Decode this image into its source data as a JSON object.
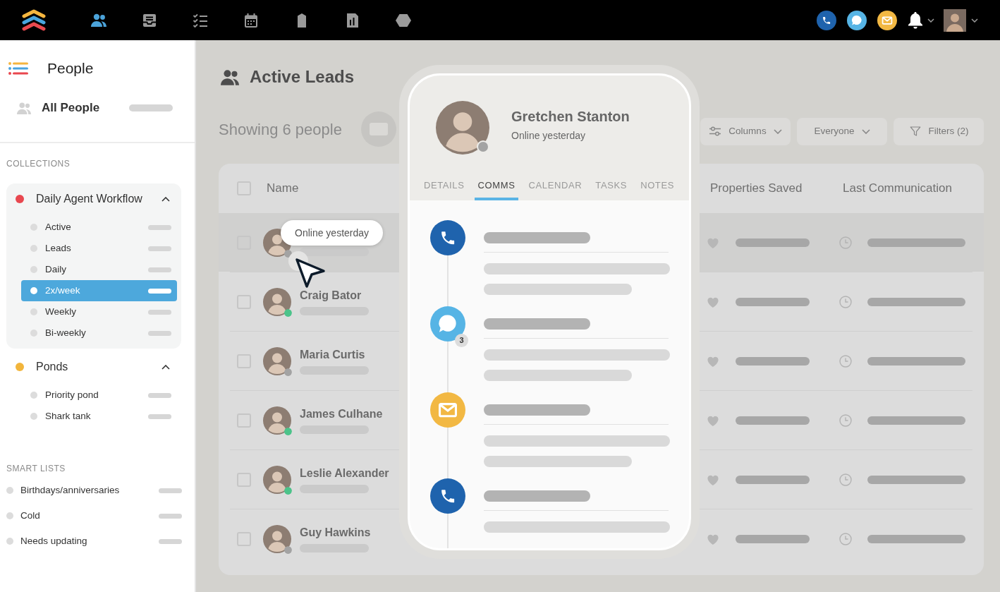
{
  "top_nav": {
    "items": [
      {
        "kind": "people",
        "selected": true
      },
      {
        "kind": "inbox",
        "selected": false
      },
      {
        "kind": "checklist",
        "selected": false
      },
      {
        "kind": "calendar",
        "selected": false
      },
      {
        "kind": "house",
        "selected": false
      },
      {
        "kind": "report",
        "selected": false
      },
      {
        "kind": "hexagon",
        "selected": false
      }
    ],
    "actions": [
      {
        "kind": "call"
      },
      {
        "kind": "message"
      },
      {
        "kind": "email"
      }
    ]
  },
  "sidebar": {
    "title": "People",
    "all_people": {
      "label": "All People",
      "selected": false
    },
    "collections": {
      "heading": "COLLECTIONS",
      "groups": [
        {
          "label": "Daily Agent Workflow",
          "color": "#e8474f",
          "expanded": true,
          "children": [
            {
              "label": "Active",
              "selected": false
            },
            {
              "label": "Leads",
              "selected": false
            },
            {
              "label": "Daily",
              "selected": false
            },
            {
              "label": "2x/week",
              "selected": true
            },
            {
              "label": "Weekly",
              "selected": false
            },
            {
              "label": "Bi-weekly",
              "selected": false
            }
          ]
        },
        {
          "label": "Ponds",
          "color": "#f2b53c",
          "expanded": true,
          "children": [
            {
              "label": "Priority pond",
              "selected": false
            },
            {
              "label": "Shark tank",
              "selected": false
            }
          ]
        }
      ]
    },
    "smart_lists": {
      "heading": "SMART LISTS",
      "items": [
        {
          "label": "Birthdays/anniversaries",
          "selected": false
        },
        {
          "label": "Cold",
          "selected": false
        },
        {
          "label": "Needs updating",
          "selected": false
        }
      ]
    }
  },
  "page": {
    "title": "Active Leads",
    "count": "Showing 6 people",
    "controls": [
      {
        "kind": "columns",
        "label": "Columns"
      },
      {
        "kind": "dropdown",
        "label": "Everyone"
      },
      {
        "kind": "filters",
        "label": "Filters (2)"
      }
    ]
  },
  "table": {
    "select_all_checked": false,
    "columns": [
      {
        "label": "Name"
      },
      {
        "label": "Properties Saved"
      },
      {
        "label": "Last Communication"
      }
    ],
    "rows": [
      {
        "hovered": true,
        "checked": false,
        "online": false,
        "tooltip": "Online yesterday"
      },
      {
        "name": "Craig Bator",
        "hovered": false,
        "checked": false,
        "online": true
      },
      {
        "name": "Maria Curtis",
        "hovered": false,
        "checked": false,
        "online": false
      },
      {
        "name": "James Culhane",
        "hovered": false,
        "checked": false,
        "online": true
      },
      {
        "name": "Leslie Alexander",
        "hovered": false,
        "checked": false,
        "online": true
      },
      {
        "name": "Guy Hawkins",
        "hovered": false,
        "checked": false,
        "online": false
      }
    ]
  },
  "contact_card": {
    "name": "Gretchen Stanton",
    "status": "Online yesterday",
    "online": false,
    "tabs": [
      {
        "label": "DETAILS",
        "selected": false
      },
      {
        "label": "COMMS",
        "selected": true
      },
      {
        "label": "CALENDAR",
        "selected": false
      },
      {
        "label": "TASKS",
        "selected": false
      },
      {
        "label": "NOTES",
        "selected": false
      }
    ],
    "timeline": [
      {
        "kind": "call"
      },
      {
        "kind": "message",
        "badge": "3"
      },
      {
        "kind": "email"
      },
      {
        "kind": "call"
      }
    ]
  }
}
